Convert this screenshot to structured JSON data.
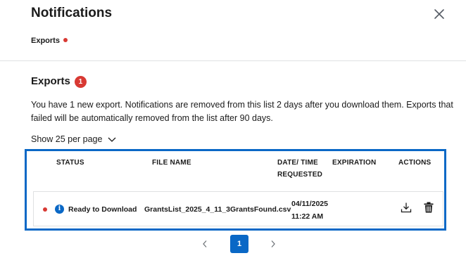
{
  "header": {
    "title": "Notifications"
  },
  "tabs": [
    {
      "label": "Exports",
      "has_dot": true
    }
  ],
  "section": {
    "title": "Exports",
    "count": "1",
    "description": "You have 1 new export. Notifications are removed from this list 2 days after you download them. Exports that failed will be automatically removed from the list after 90 days."
  },
  "per_page": {
    "label": "Show 25 per page"
  },
  "table": {
    "columns": [
      "STATUS",
      "FILE NAME",
      "DATE/ TIME\nREQUESTED",
      "EXPIRATION",
      "ACTIONS"
    ],
    "rows": [
      {
        "status": "Ready to Download",
        "file_name": "GrantsList_2025_4_11_3GrantsFound.csv",
        "date": "04/11/2025",
        "time": "11:22 AM",
        "expiration": ""
      }
    ]
  },
  "pagination": {
    "current": "1"
  },
  "colors": {
    "accent": "#0a68c6",
    "alert": "#d83933"
  },
  "icons": [
    "close-icon",
    "chevron-down-icon",
    "info-icon",
    "download-icon",
    "trash-icon",
    "chevron-left-icon",
    "chevron-right-icon"
  ]
}
